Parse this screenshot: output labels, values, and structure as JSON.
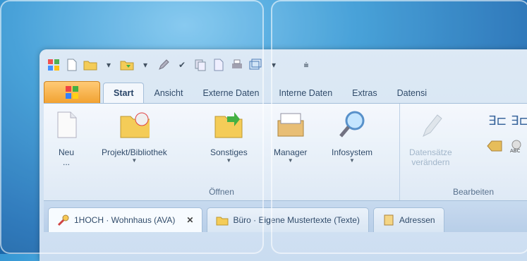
{
  "ribbon": {
    "tabs": [
      "Start",
      "Ansicht",
      "Externe Daten",
      "Interne Daten",
      "Extras",
      "Datensi"
    ],
    "groups": {
      "open": {
        "label": "Öffnen",
        "buttons": {
          "neu": "Neu",
          "neu_more": "...",
          "projekt": "Projekt/Bibliothek",
          "sonstiges": "Sonstiges",
          "manager": "Manager",
          "infosystem": "Infosystem"
        }
      },
      "edit": {
        "label": "Bearbeiten",
        "buttons": {
          "datensaetze_line1": "Datensätze",
          "datensaetze_line2": "verändern"
        }
      }
    }
  },
  "doc_tabs": {
    "active": "1HOCH · Wohnhaus (AVA)",
    "close": "✕",
    "second": "Büro · Eigene Mustertexte (Texte)",
    "third": "Adressen"
  },
  "icons": {
    "app": "windows-logo-icon",
    "qat": [
      "app-icon",
      "new-doc-icon",
      "open-folder-icon",
      "save-icon",
      "edit-icon",
      "check-icon",
      "copy-icon",
      "document-icon",
      "print-icon",
      "window-icon",
      "dropdown-icon"
    ]
  },
  "colors": {
    "app_button": "#f19b21",
    "background": "#1f6fb6",
    "ribbon": "#f4f8fd"
  }
}
